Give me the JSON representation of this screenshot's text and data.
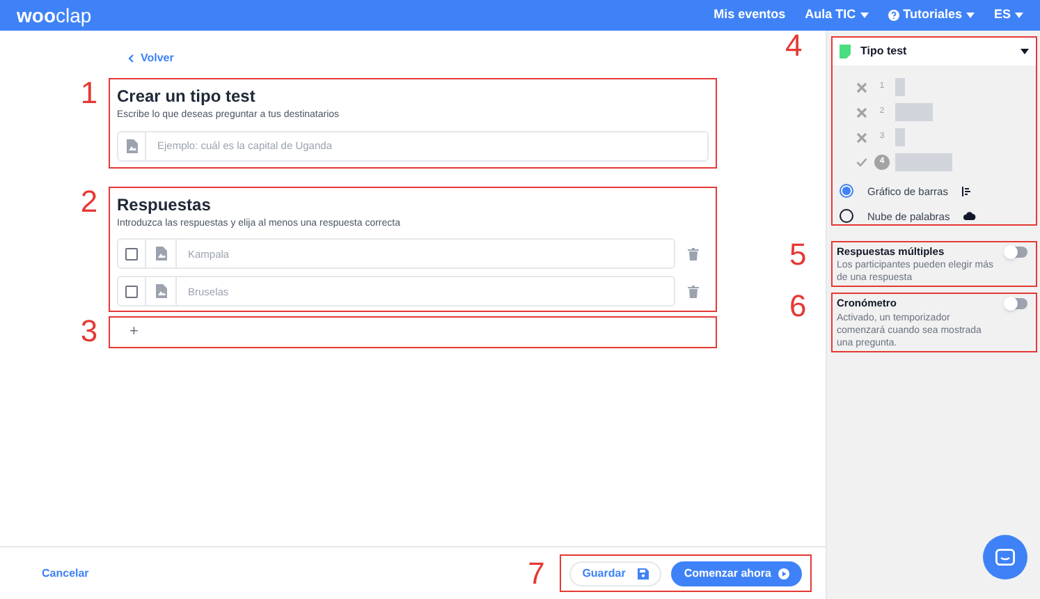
{
  "brand": {
    "bold": "woo",
    "light": "clap"
  },
  "nav": [
    {
      "label": "Mis eventos",
      "kind": "plain",
      "dropdown": false
    },
    {
      "label": "Aula TIC",
      "kind": "plain",
      "dropdown": true
    },
    {
      "label": "Tutoriales",
      "kind": "help",
      "dropdown": true
    },
    {
      "label": "ES",
      "kind": "plain",
      "dropdown": true
    }
  ],
  "back": "Volver",
  "question": {
    "marker": "1",
    "title": "Crear un tipo test",
    "subtitle": "Escribe lo que deseas preguntar a tus destinatarios",
    "placeholder": "Ejemplo: cuál es la capital de Uganda"
  },
  "answers": {
    "marker": "2",
    "title": "Respuestas",
    "subtitle": "Introduzca las respuestas y elija al menos una respuesta correcta",
    "items": [
      {
        "placeholder": "Kampala",
        "checked": false
      },
      {
        "placeholder": "Bruselas",
        "checked": false
      }
    ]
  },
  "add": {
    "marker": "3",
    "label": "+"
  },
  "type_panel": {
    "marker": "4",
    "title": "Tipo test",
    "preview": [
      {
        "number": "1",
        "correct": false
      },
      {
        "number": "2",
        "correct": false
      },
      {
        "number": "3",
        "correct": false
      },
      {
        "number": "4",
        "correct": true
      }
    ],
    "options": [
      {
        "label": "Gráfico de barras",
        "kind": "bars",
        "selected": true
      },
      {
        "label": "Nube de palabras",
        "kind": "cloud",
        "selected": false
      }
    ]
  },
  "settings": [
    {
      "marker": "5",
      "title": "Respuestas múltiples",
      "description": "Los participantes pueden elegir más de una respuesta",
      "on": false
    },
    {
      "marker": "6",
      "title": "Cronómetro",
      "description": "Activado, un temporizador comenzará cuando sea mostrada una pregunta.",
      "on": false
    }
  ],
  "footer": {
    "cancel": "Cancelar",
    "marker": "7",
    "save": "Guardar",
    "start": "Comenzar ahora"
  }
}
